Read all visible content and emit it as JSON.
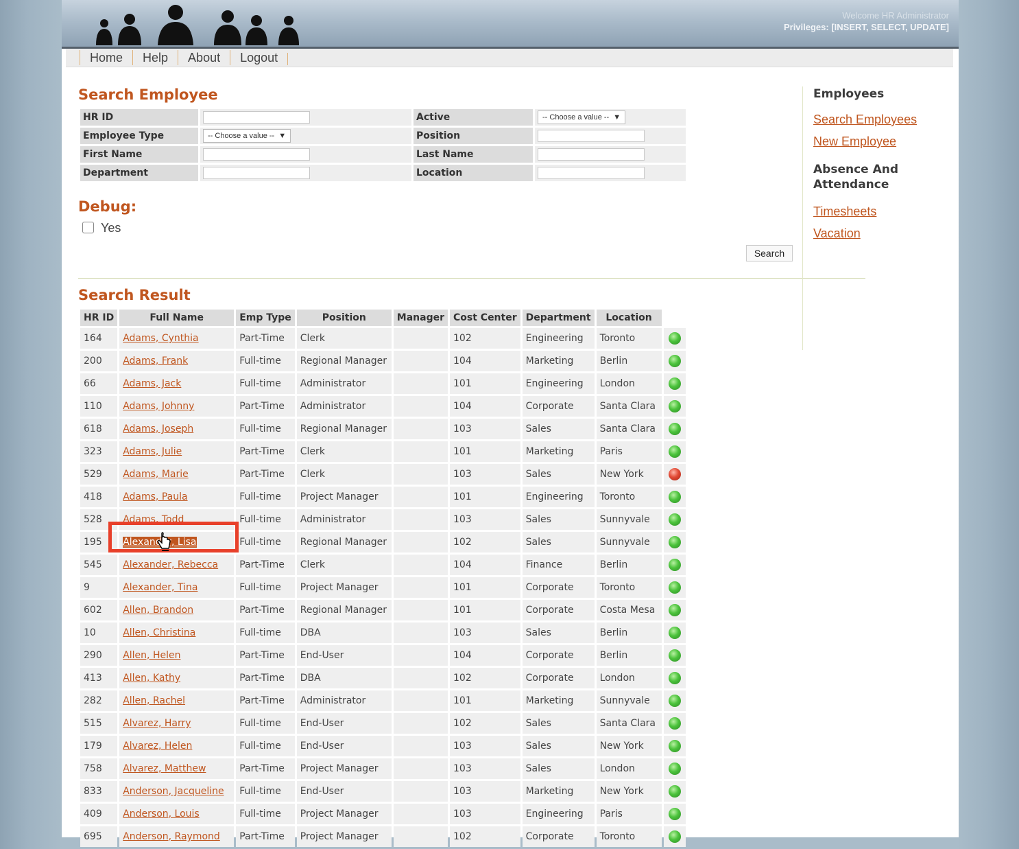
{
  "header": {
    "welcome": "Welcome HR Administrator",
    "privileges": "Privileges: [INSERT, SELECT, UPDATE]"
  },
  "nav": [
    "Home",
    "Help",
    "About",
    "Logout"
  ],
  "search": {
    "title": "Search Employee",
    "labels": {
      "hr_id": "HR ID",
      "active": "Active",
      "employee_type": "Employee Type",
      "position": "Position",
      "first_name": "First Name",
      "last_name": "Last Name",
      "department": "Department",
      "location": "Location"
    },
    "select_placeholder": "-- Choose a value --",
    "debug_title": "Debug:",
    "debug_option": "Yes",
    "button": "Search"
  },
  "sidebar": {
    "employees_head": "Employees",
    "links1": [
      "Search Employees",
      "New Employee"
    ],
    "absence_head_1": "Absence And",
    "absence_head_2": "Attendance",
    "links2": [
      "Timesheets",
      "Vacation"
    ]
  },
  "results": {
    "title": "Search Result",
    "columns": [
      "HR ID",
      "Full Name",
      "Emp Type",
      "Position",
      "Manager",
      "Cost Center",
      "Department",
      "Location"
    ],
    "rows": [
      {
        "id": "164",
        "name": "Adams, Cynthia",
        "type": "Part-Time",
        "position": "Clerk",
        "manager": "",
        "cc": "102",
        "dept": "Engineering",
        "loc": "Toronto",
        "status": "green"
      },
      {
        "id": "200",
        "name": "Adams, Frank",
        "type": "Full-time",
        "position": "Regional Manager",
        "manager": "",
        "cc": "104",
        "dept": "Marketing",
        "loc": "Berlin",
        "status": "green"
      },
      {
        "id": "66",
        "name": "Adams, Jack",
        "type": "Full-time",
        "position": "Administrator",
        "manager": "",
        "cc": "101",
        "dept": "Engineering",
        "loc": "London",
        "status": "green"
      },
      {
        "id": "110",
        "name": "Adams, Johnny",
        "type": "Part-Time",
        "position": "Administrator",
        "manager": "",
        "cc": "104",
        "dept": "Corporate",
        "loc": "Santa Clara",
        "status": "green"
      },
      {
        "id": "618",
        "name": "Adams, Joseph",
        "type": "Full-time",
        "position": "Regional Manager",
        "manager": "",
        "cc": "103",
        "dept": "Sales",
        "loc": "Santa Clara",
        "status": "green"
      },
      {
        "id": "323",
        "name": "Adams, Julie",
        "type": "Part-Time",
        "position": "Clerk",
        "manager": "",
        "cc": "101",
        "dept": "Marketing",
        "loc": "Paris",
        "status": "green"
      },
      {
        "id": "529",
        "name": "Adams, Marie",
        "type": "Part-Time",
        "position": "Clerk",
        "manager": "",
        "cc": "103",
        "dept": "Sales",
        "loc": "New York",
        "status": "red"
      },
      {
        "id": "418",
        "name": "Adams, Paula",
        "type": "Full-time",
        "position": "Project Manager",
        "manager": "",
        "cc": "101",
        "dept": "Engineering",
        "loc": "Toronto",
        "status": "green"
      },
      {
        "id": "528",
        "name": "Adams, Todd",
        "type": "Full-time",
        "position": "Administrator",
        "manager": "",
        "cc": "103",
        "dept": "Sales",
        "loc": "Sunnyvale",
        "status": "green"
      },
      {
        "id": "195",
        "name": "Alexander, Lisa",
        "type": "Full-time",
        "position": "Regional Manager",
        "manager": "",
        "cc": "102",
        "dept": "Sales",
        "loc": "Sunnyvale",
        "status": "green"
      },
      {
        "id": "545",
        "name": "Alexander, Rebecca",
        "type": "Part-Time",
        "position": "Clerk",
        "manager": "",
        "cc": "104",
        "dept": "Finance",
        "loc": "Berlin",
        "status": "green"
      },
      {
        "id": "9",
        "name": "Alexander, Tina",
        "type": "Full-time",
        "position": "Project Manager",
        "manager": "",
        "cc": "101",
        "dept": "Corporate",
        "loc": "Toronto",
        "status": "green"
      },
      {
        "id": "602",
        "name": "Allen, Brandon",
        "type": "Part-Time",
        "position": "Regional Manager",
        "manager": "",
        "cc": "101",
        "dept": "Corporate",
        "loc": "Costa Mesa",
        "status": "green"
      },
      {
        "id": "10",
        "name": "Allen, Christina",
        "type": "Full-time",
        "position": "DBA",
        "manager": "",
        "cc": "103",
        "dept": "Sales",
        "loc": "Berlin",
        "status": "green"
      },
      {
        "id": "290",
        "name": "Allen, Helen",
        "type": "Part-Time",
        "position": "End-User",
        "manager": "",
        "cc": "104",
        "dept": "Corporate",
        "loc": "Berlin",
        "status": "green"
      },
      {
        "id": "413",
        "name": "Allen, Kathy",
        "type": "Part-Time",
        "position": "DBA",
        "manager": "",
        "cc": "102",
        "dept": "Corporate",
        "loc": "London",
        "status": "green"
      },
      {
        "id": "282",
        "name": "Allen, Rachel",
        "type": "Part-Time",
        "position": "Administrator",
        "manager": "",
        "cc": "101",
        "dept": "Marketing",
        "loc": "Sunnyvale",
        "status": "green"
      },
      {
        "id": "515",
        "name": "Alvarez, Harry",
        "type": "Full-time",
        "position": "End-User",
        "manager": "",
        "cc": "102",
        "dept": "Sales",
        "loc": "Santa Clara",
        "status": "green"
      },
      {
        "id": "179",
        "name": "Alvarez, Helen",
        "type": "Full-time",
        "position": "End-User",
        "manager": "",
        "cc": "103",
        "dept": "Sales",
        "loc": "New York",
        "status": "green"
      },
      {
        "id": "758",
        "name": "Alvarez, Matthew",
        "type": "Part-Time",
        "position": "Project Manager",
        "manager": "",
        "cc": "103",
        "dept": "Sales",
        "loc": "London",
        "status": "green"
      },
      {
        "id": "833",
        "name": "Anderson, Jacqueline",
        "type": "Full-time",
        "position": "End-User",
        "manager": "",
        "cc": "103",
        "dept": "Marketing",
        "loc": "New York",
        "status": "green"
      },
      {
        "id": "409",
        "name": "Anderson, Louis",
        "type": "Full-time",
        "position": "Project Manager",
        "manager": "",
        "cc": "103",
        "dept": "Engineering",
        "loc": "Paris",
        "status": "green"
      },
      {
        "id": "695",
        "name": "Anderson, Raymond",
        "type": "Part-Time",
        "position": "Project Manager",
        "manager": "",
        "cc": "102",
        "dept": "Corporate",
        "loc": "Toronto",
        "status": "green"
      }
    ]
  },
  "colors": {
    "accent": "#c0561f",
    "highlight_box": "#e8402a",
    "status_green": "#4cc33c",
    "status_red": "#e24a35"
  },
  "highlighted_row": "Alexander, Lisa"
}
